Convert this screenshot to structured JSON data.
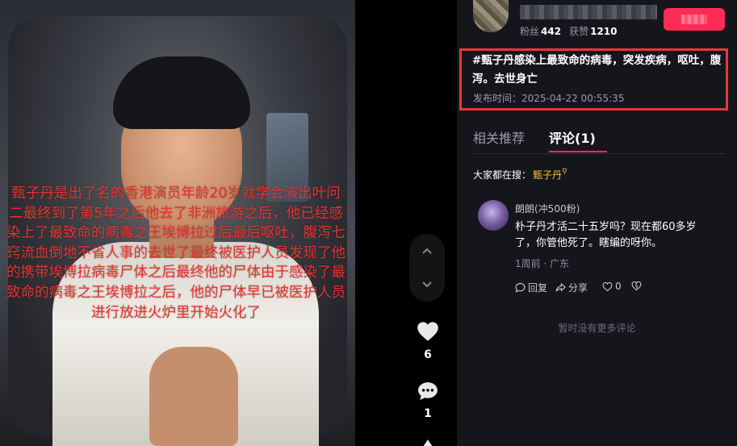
{
  "video": {
    "overlay_text": "甄子丹是出了名的香港演员年龄20岁就学会演出叶问二最终到了第5年之后他去了非洲旅游之后，他已经感染上了最致命的病毒之王埃博拉过后最后呕吐，腹泻七窍流血倒地不省人事的去世了最终被医护人员发现了他的携带埃博拉病毒尸体之后最终他的尸体由于感染了最致命的病毒之王埃博拉之后，他的尸体早已被医护人员进行放进火炉里开始火化了"
  },
  "actions": {
    "likes": "6",
    "comments": "1"
  },
  "author": {
    "fans_label": "粉丝",
    "fans_count": "442",
    "likes_label": "获赞",
    "likes_count": "1210"
  },
  "post": {
    "title": "#甄子丹感染上最致命的病毒，突发疾病，呕吐，腹泻。去世身亡",
    "publish_time": "发布时间：2025-04-22 00:55:35"
  },
  "tabs": [
    {
      "label": "相关推荐"
    },
    {
      "label": "评论(1)"
    }
  ],
  "search_hint": {
    "prefix": "大家都在搜：",
    "keyword": "甄子丹"
  },
  "comment": {
    "user": "朗朗(冲500粉)",
    "text": "朴子丹才活二十五岁吗？现在都60多岁了，你管他死了。瞎编的呀你。",
    "meta": "1周前 · 广东",
    "reply_label": "回复",
    "share_label": "分享",
    "like_count": "0"
  },
  "no_more": "暂时没有更多评论",
  "colors": {
    "accent": "#fe2c55",
    "highlight_border": "#e53935",
    "overlay_text": "#e8322e",
    "keyword": "#f5c242"
  }
}
